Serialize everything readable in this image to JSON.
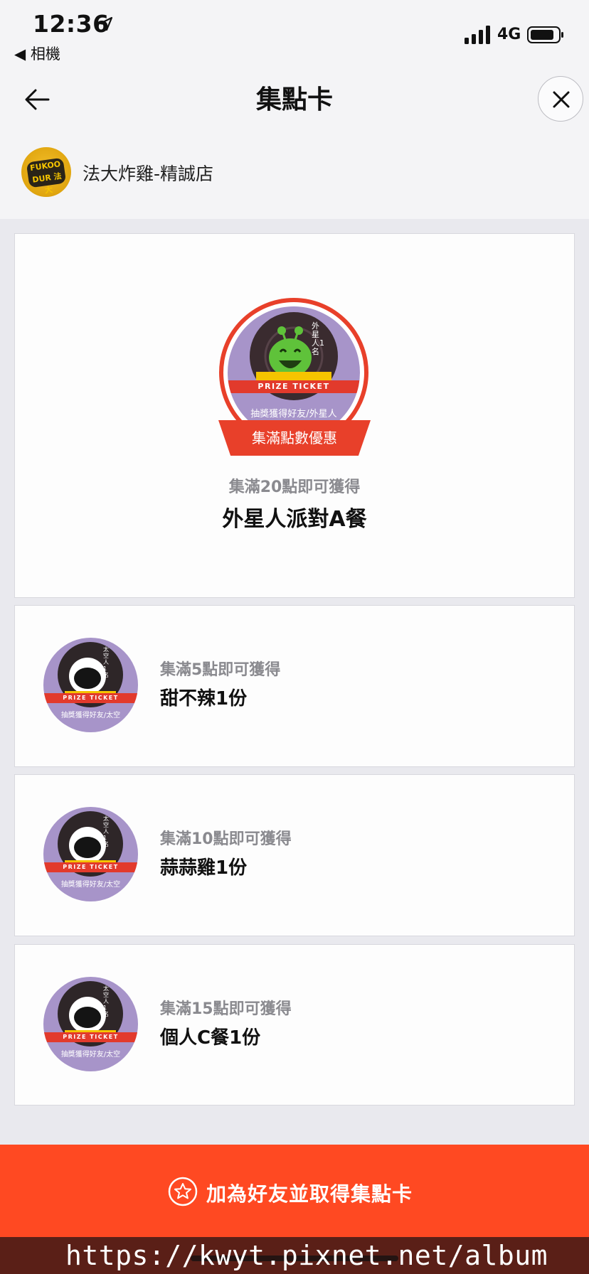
{
  "status_bar": {
    "time": "12:36",
    "back_app": "◀ 相機",
    "network": "4G"
  },
  "header": {
    "title": "集點卡"
  },
  "store": {
    "name": "法大炸雞-精誠店",
    "logo_text": "FUKOO DUR 法大"
  },
  "main_reward": {
    "ribbon_label": "集滿點數優惠",
    "ticket_label": "PRIZE TICKET",
    "badge_text": "外星人1名",
    "badge_caption": "抽獎獲得好友/外星人",
    "subtitle": "集滿20點即可獲得",
    "title": "外星人派對A餐"
  },
  "rewards": [
    {
      "ticket_label": "PRIZE TICKET",
      "badge_text": "太空人1名",
      "badge_caption": "抽獎獲得好友/太空",
      "subtitle": "集滿5點即可獲得",
      "title": "甜不辣1份"
    },
    {
      "ticket_label": "PRIZE TICKET",
      "badge_text": "太空人1名",
      "badge_caption": "抽獎獲得好友/太空",
      "subtitle": "集滿10點即可獲得",
      "title": "蒜蒜雞1份"
    },
    {
      "ticket_label": "PRIZE TICKET",
      "badge_text": "太空人1名",
      "badge_caption": "抽獎獲得好友/太空",
      "subtitle": "集滿15點即可獲得",
      "title": "個人C餐1份"
    }
  ],
  "cta": {
    "label": "加為好友並取得集點卡",
    "icon": "star-circle-icon"
  },
  "watermark": "https://kwyt.pixnet.net/album",
  "colors": {
    "accent": "#ff4922",
    "badge_purple": "#a794c9",
    "ribbon_red": "#e23a2c"
  }
}
